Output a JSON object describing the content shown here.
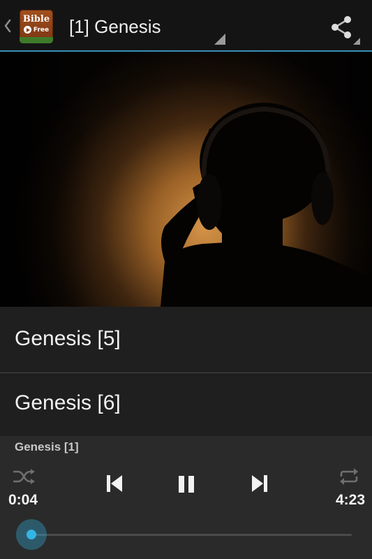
{
  "app_icon": {
    "top_text": "Bible",
    "bottom_text": "Free",
    "name": "bible-free-app-icon"
  },
  "actionbar": {
    "title": "[1] Genesis",
    "up_icon": "chevron-left-icon",
    "share_icon": "share-icon",
    "accent_color": "#33b5e5"
  },
  "hero": {
    "icon": "silhouette-headphones-image"
  },
  "playlist": {
    "items": [
      {
        "label": "Genesis [5]"
      },
      {
        "label": "Genesis [6]"
      }
    ]
  },
  "player": {
    "now_playing": "Genesis [1]",
    "elapsed": "0:04",
    "duration": "4:23",
    "progress": 0.015,
    "controls": {
      "shuffle_icon": "shuffle-icon",
      "previous_icon": "skip-previous-icon",
      "pause_icon": "pause-icon",
      "next_icon": "skip-next-icon",
      "repeat_icon": "repeat-icon"
    },
    "accent_color": "#33b5e5"
  }
}
